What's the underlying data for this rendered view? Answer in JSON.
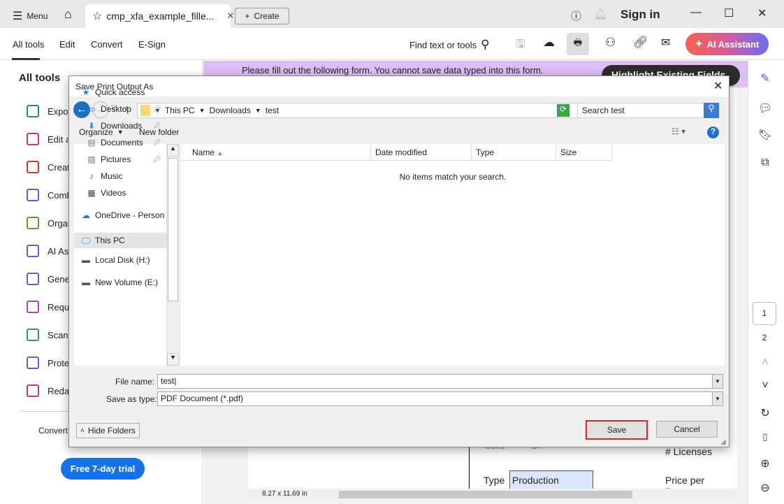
{
  "titlebar": {
    "menu": "Menu",
    "tab_title": "cmp_xfa_example_fille...",
    "create": "Create",
    "sign_in": "Sign in"
  },
  "toolbar": {
    "tabs": [
      "All tools",
      "Edit",
      "Convert",
      "E-Sign"
    ],
    "find": "Find text or tools",
    "ai_assistant": "AI Assistant"
  },
  "left_panel": {
    "heading": "All tools",
    "tools": [
      "Expor",
      "Edit a",
      "Create",
      "Comb",
      "Organ",
      "AI Ass",
      "Gener",
      "Reque",
      "Scan",
      "Prote",
      "Redac"
    ],
    "footer_text": "Convert,",
    "trial_button": "Free 7-day trial"
  },
  "document": {
    "banner": "Please fill out the following form. You cannot save data typed into this form.",
    "highlight_button": "Highlight Existing Fields",
    "radio_java": "Java",
    "radio_csharp": "C#",
    "licenses_label": "# Licenses",
    "type_label": "Type",
    "type_value": "Production",
    "price_label": "Price per license",
    "page_size": "8.27 x 11.69 in"
  },
  "rail": {
    "pages": [
      "1",
      "2"
    ]
  },
  "dialog": {
    "title": "Save Print Output As",
    "breadcrumb": [
      "This PC",
      "Downloads",
      "test"
    ],
    "search_placeholder": "Search test",
    "organize": "Organize",
    "new_folder": "New folder",
    "nav": [
      {
        "label": "Quick access",
        "icon": "star"
      },
      {
        "label": "Desktop",
        "icon": "desktop",
        "pinned": true
      },
      {
        "label": "Downloads",
        "icon": "download",
        "pinned": true
      },
      {
        "label": "Documents",
        "icon": "document",
        "pinned": true
      },
      {
        "label": "Pictures",
        "icon": "picture",
        "pinned": true
      },
      {
        "label": "Music",
        "icon": "music"
      },
      {
        "label": "Videos",
        "icon": "video"
      },
      {
        "label": "OneDrive - Person",
        "icon": "cloud"
      },
      {
        "label": "This PC",
        "icon": "computer",
        "selected": true
      },
      {
        "label": "Local Disk (H:)",
        "icon": "drive"
      },
      {
        "label": "New Volume (E:)",
        "icon": "drive"
      }
    ],
    "columns": [
      "Name",
      "Date modified",
      "Type",
      "Size"
    ],
    "empty_message": "No items match your search.",
    "file_name_label": "File name:",
    "file_name_value": "test",
    "save_type_label": "Save as type:",
    "save_type_value": "PDF Document (*.pdf)",
    "hide_folders": "Hide Folders",
    "save": "Save",
    "cancel": "Cancel",
    "highlight_color": "#e8231f"
  }
}
